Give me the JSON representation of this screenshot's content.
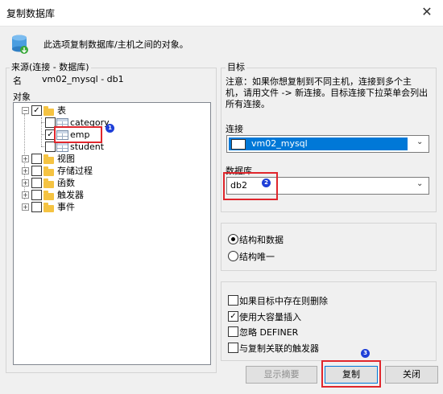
{
  "window": {
    "title": "复制数据库",
    "close_glyph": "✕"
  },
  "description": "此选项复制数据库/主机之间的对象。",
  "source": {
    "group_label": "来源(连接 - 数据库)",
    "name_label": "名",
    "name_value": "vm02_mysql - db1",
    "objects_label": "对象",
    "tree": {
      "tables_label": "表",
      "tables": [
        "category",
        "emp",
        "student"
      ],
      "emp_checked": true,
      "others": [
        "视图",
        "存储过程",
        "函数",
        "触发器",
        "事件"
      ]
    }
  },
  "target": {
    "group_label": "目标",
    "note": [
      "注意：如果你想复制到不同主机，连接到多个主",
      "机，请用文件 -> 新连接。目标连接下拉菜单会列出",
      "所有连接。"
    ],
    "connection_label": "连接",
    "connection_value": "vm02_mysql",
    "database_label": "数据库",
    "database_value": "db2"
  },
  "mode": {
    "options": [
      "结构和数据",
      "结构唯一"
    ],
    "selected": "结构和数据"
  },
  "options": [
    {
      "label": "如果目标中存在则删除",
      "checked": false
    },
    {
      "label": "使用大容量插入",
      "checked": true
    },
    {
      "label": "忽略 DEFINER",
      "checked": false
    },
    {
      "label": "与复制关联的触发器",
      "checked": false
    }
  ],
  "buttons": {
    "summary": "显示摘要",
    "copy": "复制",
    "close": "关闭"
  },
  "annotations": {
    "badge1": "1",
    "badge2": "2",
    "badge3": "3",
    "accent": "#e0262c",
    "badge_color": "#1e3fd8",
    "selection_color": "#0078d7"
  }
}
